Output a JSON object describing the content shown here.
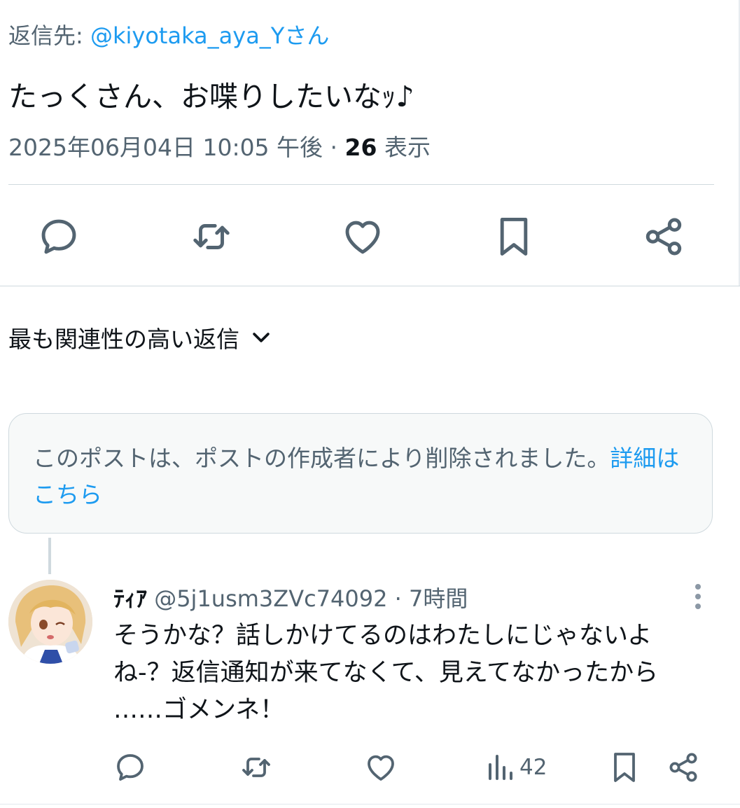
{
  "post": {
    "reply_prefix": "返信先: ",
    "reply_handle": "@kiyotaka_aya_Yさん",
    "text": "たっくさん、お喋りしたいなｯ♪",
    "timestamp": "2025年06月04日 10:05 午後",
    "separator": " · ",
    "views_count": "26",
    "views_label": " 表示"
  },
  "actions": {
    "icons": [
      "reply-icon",
      "repost-icon",
      "like-icon",
      "bookmark-icon",
      "share-icon"
    ]
  },
  "sort": {
    "label": "最も関連性の高い返信"
  },
  "deleted_notice": {
    "text": "このポストは、ポストの作成者により削除されました。",
    "link": "詳細はこちら"
  },
  "reply": {
    "name": "ﾃｨｱ",
    "handle": "@5j1usm3ZVc74092",
    "separator": " · ",
    "time": "7時間",
    "text_lines": [
      "そうかな？話しかけてるのはわたしにじゃないよ",
      "ね-？返信通知が来てなくて、見えてなかったから",
      "……ゴメンネ！"
    ],
    "views_count": "42"
  },
  "colors": {
    "accent": "#1d9bf0",
    "text_primary": "#0f1419",
    "text_secondary": "#536471",
    "border": "#cfd9de"
  }
}
